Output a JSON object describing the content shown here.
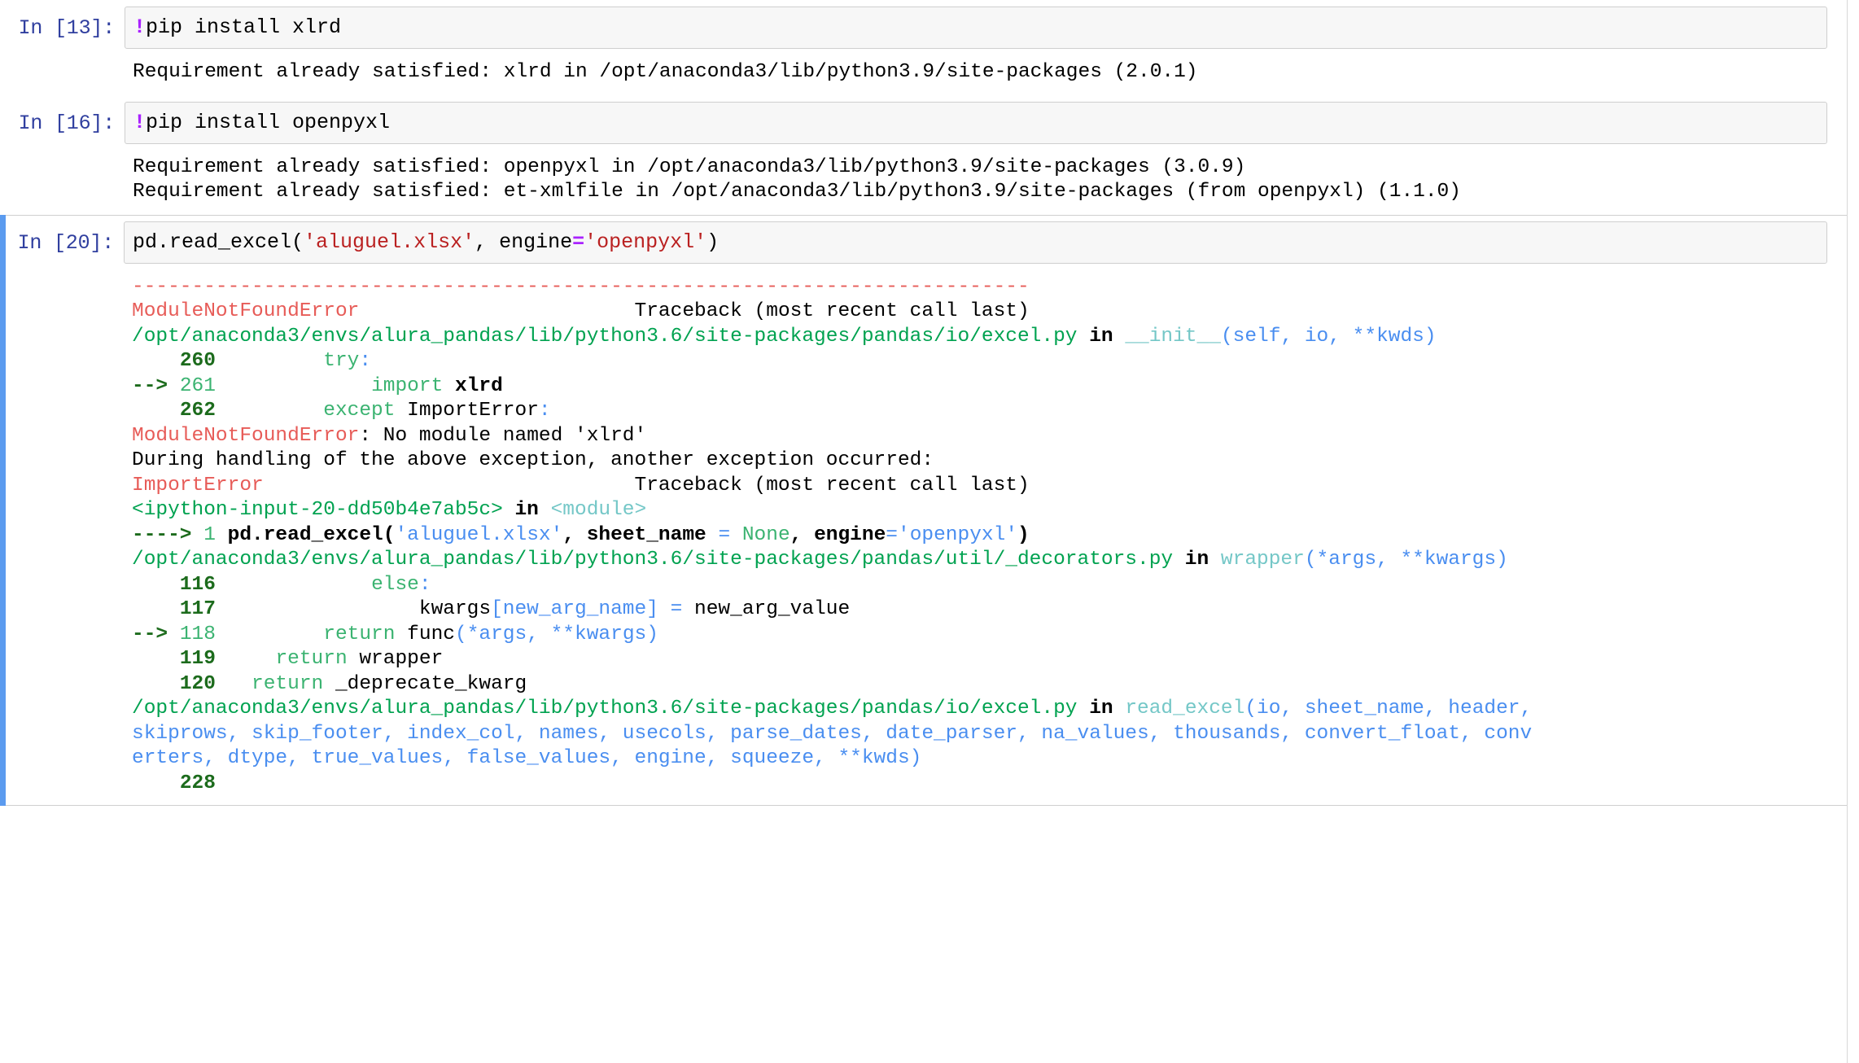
{
  "app": "jupyter-notebook",
  "scrollbar": {
    "visible": true
  },
  "cells": [
    {
      "prompt": "In [13]:",
      "input_segments": [
        {
          "text": "!",
          "cls": "tok-op"
        },
        {
          "text": "pip install xlrd",
          "cls": "tok-name"
        }
      ],
      "output_lines": [
        "Requirement already satisfied: xlrd in /opt/anaconda3/lib/python3.9/site-packages (2.0.1)"
      ]
    },
    {
      "prompt": "In [16]:",
      "input_segments": [
        {
          "text": "!",
          "cls": "tok-op"
        },
        {
          "text": "pip install openpyxl",
          "cls": "tok-name"
        }
      ],
      "output_lines": [
        "Requirement already satisfied: openpyxl in /opt/anaconda3/lib/python3.9/site-packages (3.0.9)",
        "Requirement already satisfied: et-xmlfile in /opt/anaconda3/lib/python3.9/site-packages (from openpyxl) (1.1.0)"
      ]
    },
    {
      "prompt": "In [20]:",
      "selected": true,
      "input_segments": [
        {
          "text": "pd.read_excel(",
          "cls": "tok-name"
        },
        {
          "text": "'aluguel.xlsx'",
          "cls": "tok-str"
        },
        {
          "text": ", engine",
          "cls": "tok-name"
        },
        {
          "text": "=",
          "cls": "tok-op"
        },
        {
          "text": "'openpyxl'",
          "cls": "tok-str"
        },
        {
          "text": ")",
          "cls": "tok-name"
        }
      ],
      "traceback": [
        [
          {
            "t": "---------------------------------------------------------------------------",
            "c": "c-red"
          }
        ],
        [
          {
            "t": "ModuleNotFoundError",
            "c": "c-red"
          },
          {
            "t": "                       Traceback (most recent call last)",
            "c": "c-black"
          }
        ],
        [
          {
            "t": "/opt/anaconda3/envs/alura_pandas/lib/python3.6/site-packages/pandas/io/excel.py",
            "c": "c-green"
          },
          {
            "t": " in ",
            "c": "c-black c-bold"
          },
          {
            "t": "__init__",
            "c": "c-cyan"
          },
          {
            "t": "(self, io, **kwds)",
            "c": "c-blue"
          }
        ],
        [
          {
            "t": "    ",
            "c": "c-black"
          },
          {
            "t": "260",
            "c": "c-dgreen"
          },
          {
            "t": "         ",
            "c": "c-black"
          },
          {
            "t": "try",
            "c": "c-green-n"
          },
          {
            "t": ":",
            "c": "c-blue"
          }
        ],
        [
          {
            "t": "--> ",
            "c": "c-dgreen"
          },
          {
            "t": "261",
            "c": "c-green-n"
          },
          {
            "t": "             ",
            "c": "c-black"
          },
          {
            "t": "import",
            "c": "c-green-n"
          },
          {
            "t": " xlrd",
            "c": "c-black c-bold"
          }
        ],
        [
          {
            "t": "    ",
            "c": "c-black"
          },
          {
            "t": "262",
            "c": "c-dgreen"
          },
          {
            "t": "         ",
            "c": "c-black"
          },
          {
            "t": "except",
            "c": "c-green-n"
          },
          {
            "t": " ImportError",
            "c": "c-black"
          },
          {
            "t": ":",
            "c": "c-blue"
          }
        ],
        [
          {
            "t": "",
            "c": "c-black"
          }
        ],
        [
          {
            "t": "ModuleNotFoundError",
            "c": "c-red"
          },
          {
            "t": ": No module named 'xlrd'",
            "c": "c-black"
          }
        ],
        [
          {
            "t": "",
            "c": "c-black"
          }
        ],
        [
          {
            "t": "During handling of the above exception, another exception occurred:",
            "c": "c-black"
          }
        ],
        [
          {
            "t": "",
            "c": "c-black"
          }
        ],
        [
          {
            "t": "ImportError",
            "c": "c-red"
          },
          {
            "t": "                               Traceback (most recent call last)",
            "c": "c-black"
          }
        ],
        [
          {
            "t": "<ipython-input-20-dd50b4e7ab5c>",
            "c": "c-green"
          },
          {
            "t": " in ",
            "c": "c-black c-bold"
          },
          {
            "t": "<module>",
            "c": "c-cyan"
          }
        ],
        [
          {
            "t": "----> ",
            "c": "c-dgreen"
          },
          {
            "t": "1",
            "c": "c-green-n"
          },
          {
            "t": " pd.read_excel(",
            "c": "c-black c-bold"
          },
          {
            "t": "'aluguel.xlsx'",
            "c": "c-blue"
          },
          {
            "t": ", sheet_name ",
            "c": "c-black c-bold"
          },
          {
            "t": "=",
            "c": "c-blue"
          },
          {
            "t": " ",
            "c": "c-black"
          },
          {
            "t": "None",
            "c": "c-green-n"
          },
          {
            "t": ", engine",
            "c": "c-black c-bold"
          },
          {
            "t": "=",
            "c": "c-blue"
          },
          {
            "t": "'openpyxl'",
            "c": "c-blue"
          },
          {
            "t": ")",
            "c": "c-black c-bold"
          }
        ],
        [
          {
            "t": "",
            "c": "c-black"
          }
        ],
        [
          {
            "t": "/opt/anaconda3/envs/alura_pandas/lib/python3.6/site-packages/pandas/util/_decorators.py",
            "c": "c-green"
          },
          {
            "t": " in ",
            "c": "c-black c-bold"
          },
          {
            "t": "wrapper",
            "c": "c-cyan"
          },
          {
            "t": "(*args, **kwargs)",
            "c": "c-blue"
          }
        ],
        [
          {
            "t": "    ",
            "c": "c-black"
          },
          {
            "t": "116",
            "c": "c-dgreen"
          },
          {
            "t": "             ",
            "c": "c-black"
          },
          {
            "t": "else",
            "c": "c-green-n"
          },
          {
            "t": ":",
            "c": "c-blue"
          }
        ],
        [
          {
            "t": "    ",
            "c": "c-black"
          },
          {
            "t": "117",
            "c": "c-dgreen"
          },
          {
            "t": "                 kwargs",
            "c": "c-black"
          },
          {
            "t": "[new_arg_name]",
            "c": "c-blue"
          },
          {
            "t": " ",
            "c": "c-black"
          },
          {
            "t": "=",
            "c": "c-blue"
          },
          {
            "t": " new_arg_value",
            "c": "c-black"
          }
        ],
        [
          {
            "t": "--> ",
            "c": "c-dgreen"
          },
          {
            "t": "118",
            "c": "c-green-n"
          },
          {
            "t": "         ",
            "c": "c-black"
          },
          {
            "t": "return",
            "c": "c-green-n"
          },
          {
            "t": " func",
            "c": "c-black"
          },
          {
            "t": "(",
            "c": "c-blue"
          },
          {
            "t": "*args",
            "c": "c-blue"
          },
          {
            "t": ", ",
            "c": "c-blue"
          },
          {
            "t": "**kwargs",
            "c": "c-blue"
          },
          {
            "t": ")",
            "c": "c-blue"
          }
        ],
        [
          {
            "t": "    ",
            "c": "c-black"
          },
          {
            "t": "119",
            "c": "c-dgreen"
          },
          {
            "t": "     ",
            "c": "c-black"
          },
          {
            "t": "return",
            "c": "c-green-n"
          },
          {
            "t": " wrapper",
            "c": "c-black"
          }
        ],
        [
          {
            "t": "    ",
            "c": "c-black"
          },
          {
            "t": "120",
            "c": "c-dgreen"
          },
          {
            "t": "   ",
            "c": "c-black"
          },
          {
            "t": "return",
            "c": "c-green-n"
          },
          {
            "t": " _deprecate_kwarg",
            "c": "c-black"
          }
        ],
        [
          {
            "t": "",
            "c": "c-black"
          }
        ],
        [
          {
            "t": "/opt/anaconda3/envs/alura_pandas/lib/python3.6/site-packages/pandas/io/excel.py",
            "c": "c-green"
          },
          {
            "t": " in ",
            "c": "c-black c-bold"
          },
          {
            "t": "read_excel",
            "c": "c-cyan"
          },
          {
            "t": "(io, sheet_name, header,",
            "c": "c-blue"
          }
        ],
        [
          {
            "t": "skiprows, skip_footer, index_col, names, usecols, parse_dates, date_parser, na_values, thousands, convert_float, conv",
            "c": "c-blue"
          }
        ],
        [
          {
            "t": "erters, dtype, true_values, false_values, engine, squeeze, **kwds)",
            "c": "c-blue"
          }
        ],
        [
          {
            "t": "    ",
            "c": "c-black"
          },
          {
            "t": "228",
            "c": "c-dgreen"
          }
        ]
      ]
    }
  ]
}
